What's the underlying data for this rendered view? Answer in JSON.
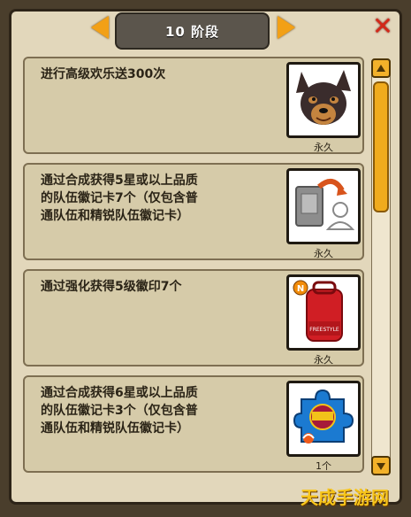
{
  "header": {
    "stage_label": "10 阶段",
    "prev_icon": "arrow-left-icon",
    "next_icon": "arrow-right-icon",
    "close_icon": "close-x-icon"
  },
  "tasks": [
    {
      "text": "进行高级欢乐送300次",
      "reward_icon": "dog-head-icon",
      "reward_caption": "永久"
    },
    {
      "text": "通过合成获得5星或以上品质\n的队伍徽记卡7个（仅包含普\n通队伍和精锐队伍徽记卡）",
      "reward_icon": "card-exchange-icon",
      "reward_caption": "永久"
    },
    {
      "text": "通过强化获得5级徽印7个",
      "reward_icon": "backpack-icon",
      "reward_caption": "永久",
      "backpack_label": "FREESTYLE"
    },
    {
      "text": "通过合成获得6星或以上品质\n的队伍徽记卡3个（仅包含普\n通队伍和精锐队伍徽记卡）",
      "reward_icon": "puzzle-emblem-icon",
      "reward_caption": "1个"
    }
  ],
  "watermark": "天成手游网",
  "colors": {
    "accent": "#f2a016",
    "panel": "#e2d7bb",
    "close": "#d42818"
  }
}
